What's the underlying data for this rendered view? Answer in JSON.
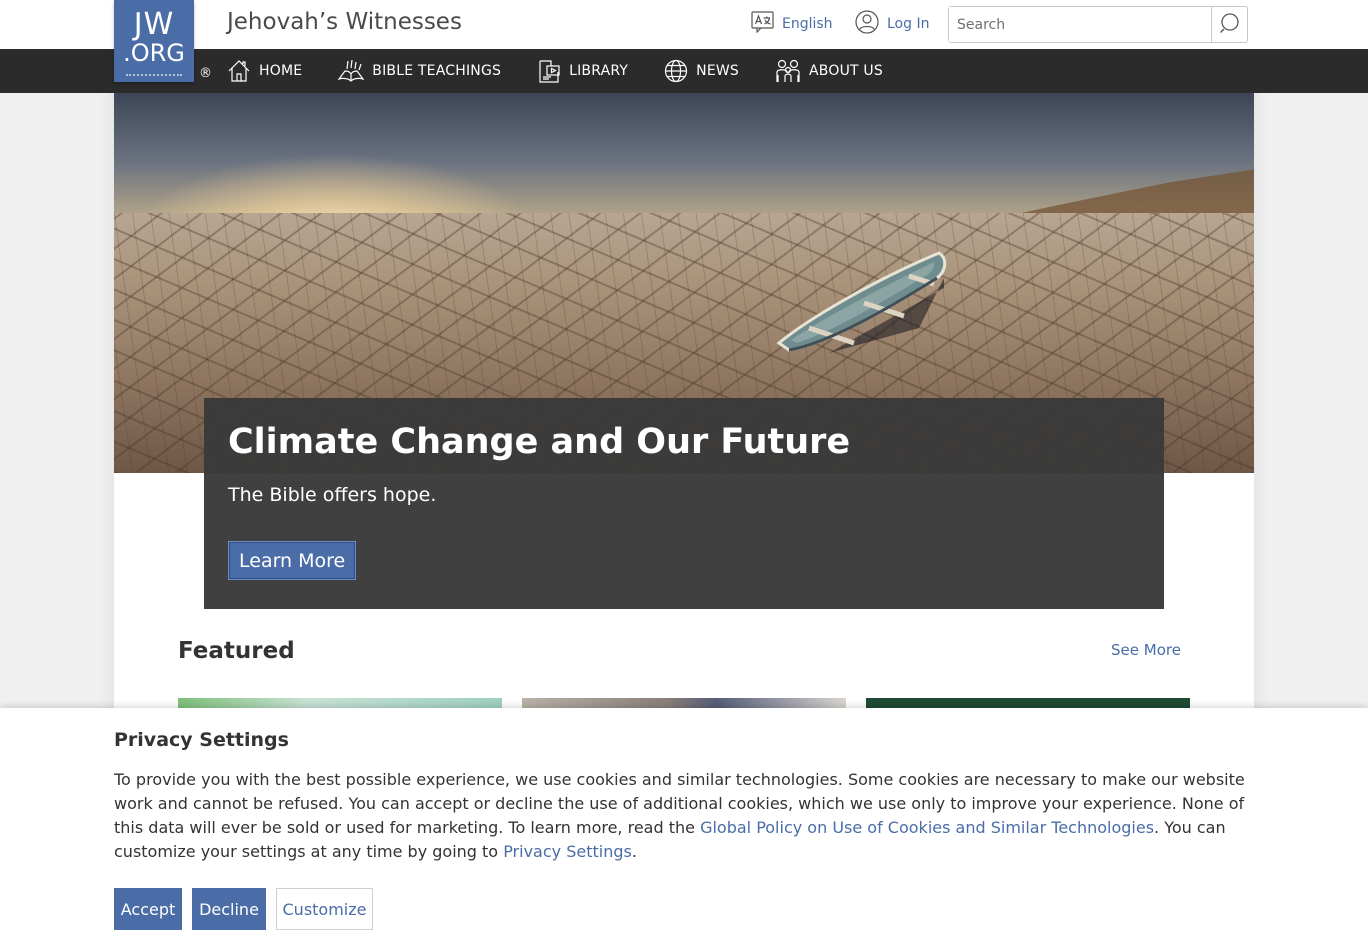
{
  "header": {
    "logo_line1": "JW",
    "logo_line2": ".ORG",
    "registered_mark": "®",
    "site_title": "Jehovah’s Witnesses",
    "language_label": "English",
    "login_label": "Log In",
    "search_placeholder": "Search"
  },
  "nav": {
    "items": [
      {
        "label": "HOME",
        "icon": "home-icon"
      },
      {
        "label": "BIBLE TEACHINGS",
        "icon": "open-bible-icon"
      },
      {
        "label": "LIBRARY",
        "icon": "library-icon"
      },
      {
        "label": "NEWS",
        "icon": "globe-icon"
      },
      {
        "label": "ABOUT US",
        "icon": "people-icon"
      }
    ]
  },
  "hero": {
    "title": "Climate Change and Our Future",
    "subtitle": "The Bible offers hope.",
    "button_label": "Learn More"
  },
  "featured": {
    "title": "Featured",
    "see_more_label": "See More"
  },
  "privacy": {
    "title": "Privacy Settings",
    "text_part1": "To provide you with the best possible experience, we use cookies and similar technologies. Some cookies are necessary to make our website work and cannot be refused. You can accept or decline the use of additional cookies, which we use only to improve your experience. None of this data will ever be sold or used for marketing. To learn more, read the ",
    "policy_link": "Global Policy on Use of Cookies and Similar Technologies",
    "text_part2": ". You can customize your settings at any time by going to ",
    "settings_link": "Privacy Settings",
    "text_part3": ".",
    "accept_label": "Accept",
    "decline_label": "Decline",
    "customize_label": "Customize"
  },
  "colors": {
    "brand_blue": "#4a6da7",
    "nav_bg": "#2b2b2b",
    "hero_card_bg": "#3a3a3a"
  }
}
